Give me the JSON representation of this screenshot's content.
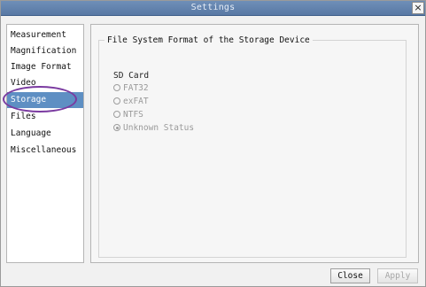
{
  "window": {
    "title": "Settings",
    "close_glyph": "×"
  },
  "sidebar": {
    "items": [
      {
        "label": "Measurement",
        "selected": false
      },
      {
        "label": "Magnification",
        "selected": false
      },
      {
        "label": "Image Format",
        "selected": false
      },
      {
        "label": "Video",
        "selected": false
      },
      {
        "label": "Storage",
        "selected": true
      },
      {
        "label": "Files",
        "selected": false
      },
      {
        "label": "Language",
        "selected": false
      },
      {
        "label": "Miscellaneous",
        "selected": false
      }
    ]
  },
  "storage": {
    "group_title": "File System Format of the Storage Device",
    "device_label": "SD Card",
    "options": [
      {
        "label": "FAT32",
        "checked": false
      },
      {
        "label": "exFAT",
        "checked": false
      },
      {
        "label": "NTFS",
        "checked": false
      },
      {
        "label": "Unknown Status",
        "checked": true
      }
    ]
  },
  "buttons": {
    "close": "Close",
    "apply": "Apply"
  },
  "colors": {
    "titlebar": "#6f8fb8",
    "selected_item": "#5e8fc3",
    "annotation_ring": "#7a3aa0"
  }
}
